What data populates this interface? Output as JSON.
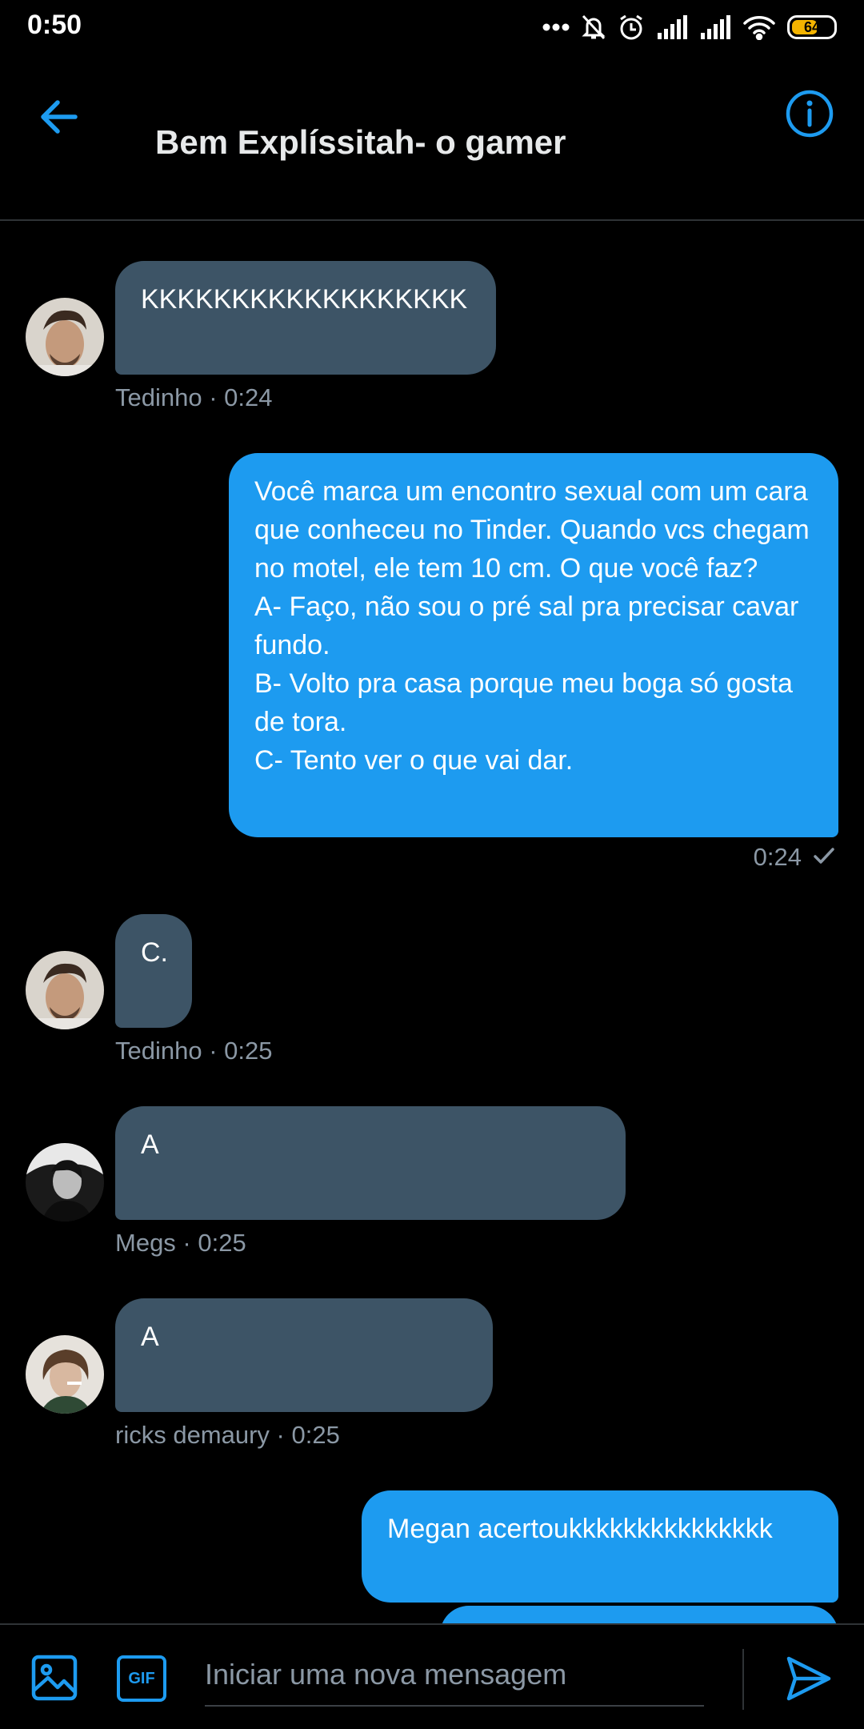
{
  "status_bar": {
    "time": "0:50",
    "battery": "64",
    "battery_level": 0.64,
    "icons": [
      "more-dots-icon",
      "bell-off-icon",
      "alarm-icon",
      "signal-1-icon",
      "signal-2-icon",
      "wifi-icon",
      "battery-icon"
    ]
  },
  "header": {
    "title": "Bem Explíssitah- o gamer",
    "back_icon": "arrow-left-icon",
    "info_icon": "info-icon"
  },
  "messages": [
    {
      "direction": "in",
      "text": "KKKKKKKKKKKKKKKKKK",
      "meta": "Tedinho · 0:24",
      "sender": "Tedinho"
    },
    {
      "direction": "out",
      "text": "Você marca um encontro sexual com um cara que conheceu no Tinder. Quando vcs chegam no motel, ele tem 10 cm. O que você faz?\nA- Faço, não sou o pré sal pra precisar cavar fundo.\nB- Volto pra casa porque meu boga só gosta de tora.\nC- Tento ver o que vai dar.",
      "meta": "0:24",
      "status_icon": "check-icon"
    },
    {
      "direction": "in",
      "text": "C.",
      "meta": "Tedinho · 0:25",
      "sender": "Tedinho"
    },
    {
      "direction": "in",
      "text": "A",
      "meta": "Megs · 0:25",
      "sender": "Megs"
    },
    {
      "direction": "in",
      "text": "A",
      "meta": "ricks demaury · 0:25",
      "sender": "ricks demaury"
    },
    {
      "direction": "out",
      "text": "Megan acertoukkkkkkkkkkkkkkk"
    }
  ],
  "composer": {
    "placeholder": "Iniciar uma nova mensagem",
    "gif_label": "GIF",
    "media_icon": "image-icon",
    "send_icon": "send-icon"
  },
  "colors": {
    "accent": "#1d9bf0",
    "incoming_bubble": "#3d5466",
    "background": "#000000",
    "meta_text": "#8b98a5"
  }
}
